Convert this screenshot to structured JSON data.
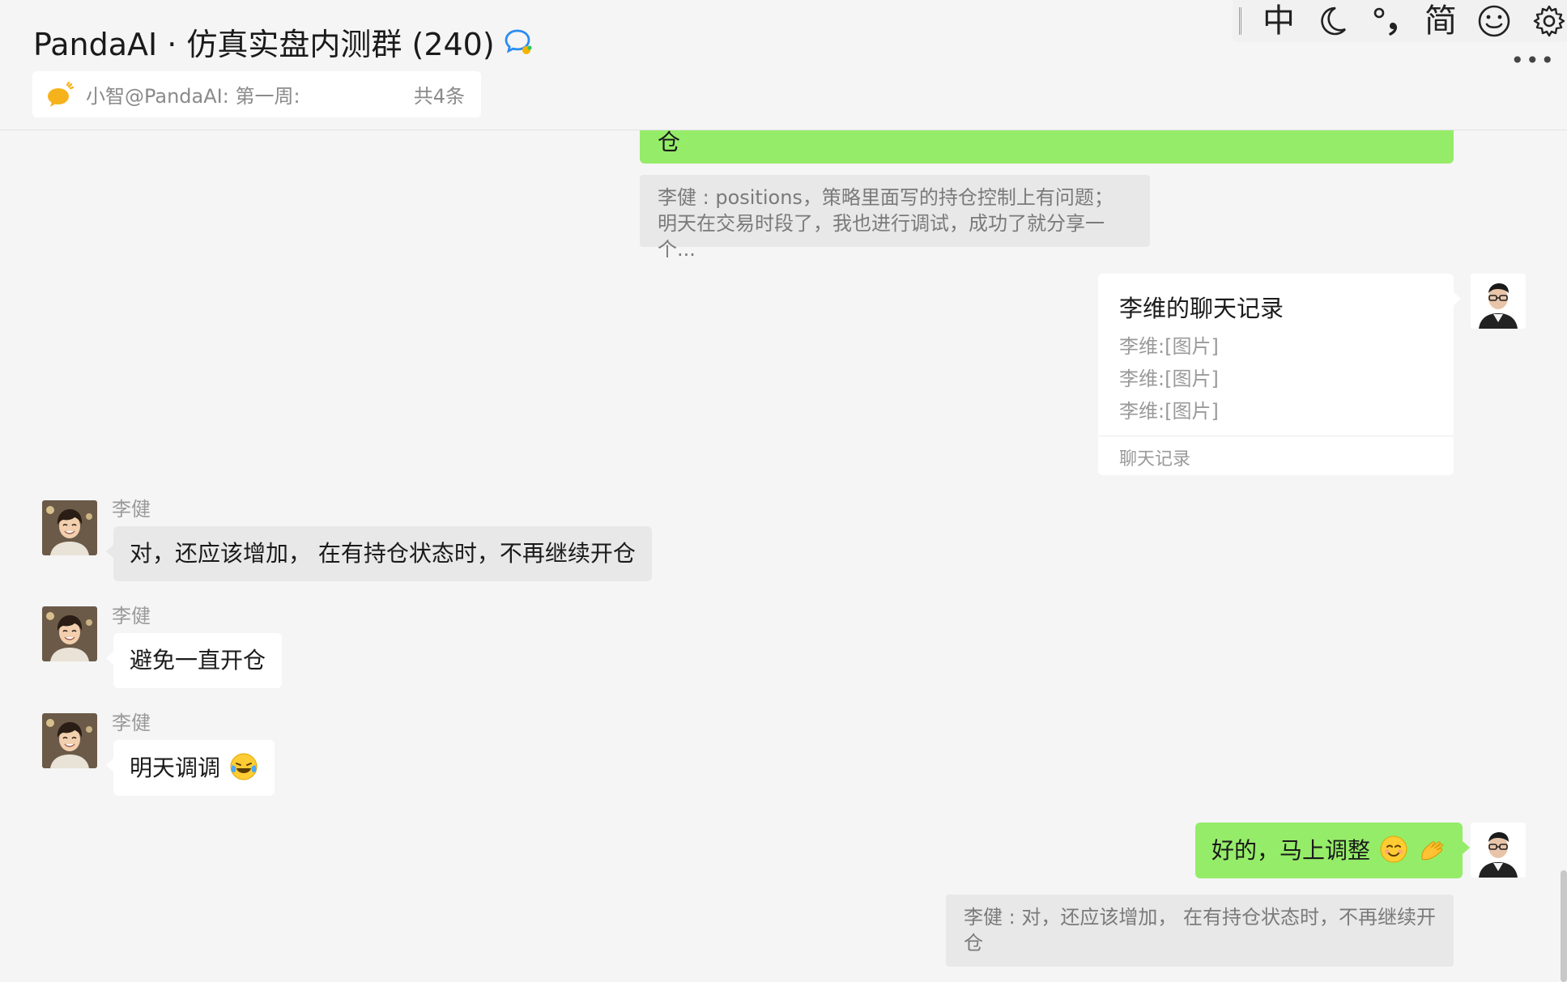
{
  "header": {
    "title": "PandaAI · 仿真实盘内测群 (240)",
    "announcement": {
      "text": "小智@PandaAI: 第一周:",
      "count": "共4条"
    }
  },
  "ime": {
    "items": [
      "中",
      "简"
    ],
    "more": "•••"
  },
  "messages": {
    "top_partial_text": "仓",
    "quote1": "李健 : positions，策略里面写的持仓控制上有问题；明天在交易时段了，我也进行调试，成功了就分享一个...",
    "chat_record": {
      "title": "李维的聊天记录",
      "lines": [
        "李维:[图片]",
        "李维:[图片]",
        "李维:[图片]"
      ],
      "footer": "聊天记录"
    },
    "msg1": {
      "sender": "李健",
      "text": "对，还应该增加， 在有持仓状态时，不再继续开仓"
    },
    "msg2": {
      "sender": "李健",
      "text": "避免一直开仓"
    },
    "msg3": {
      "sender": "李健",
      "text": "明天调调"
    },
    "reply": {
      "text": "好的，马上调整"
    },
    "quote2": "李健 : 对，还应该增加， 在有持仓状态时，不再继续开仓"
  },
  "colors": {
    "background": "#f5f5f5",
    "self_bubble": "#95ec69",
    "other_bubble": "#ffffff",
    "quote": "#e8e8e8",
    "accent_icon": "#2b8cf2"
  }
}
